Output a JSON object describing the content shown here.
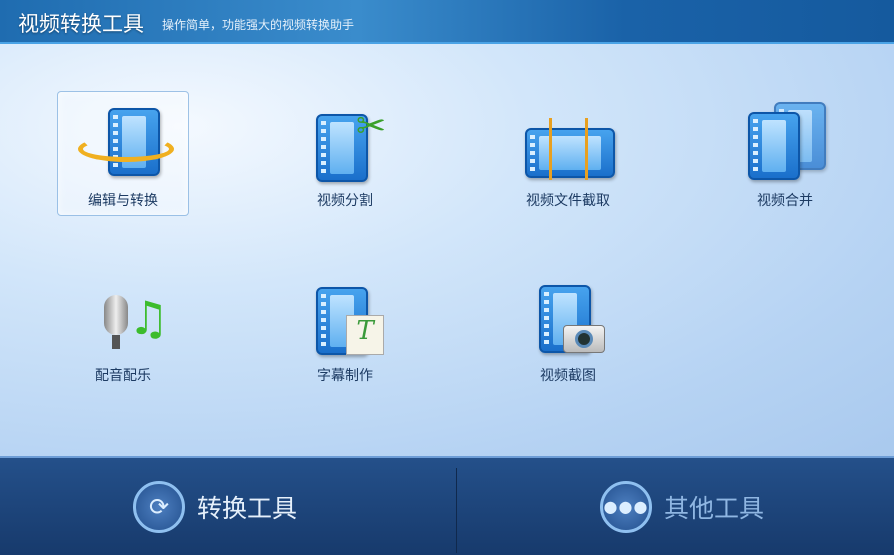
{
  "header": {
    "title": "视频转换工具",
    "subtitle": "操作简单，功能强大的视频转换助手"
  },
  "tools": [
    {
      "label": "编辑与转换",
      "icon": "film-convert-icon",
      "selected": true
    },
    {
      "label": "视频分割",
      "icon": "film-scissors-icon"
    },
    {
      "label": "视频文件截取",
      "icon": "film-clip-icon"
    },
    {
      "label": "视频合并",
      "icon": "film-merge-icon"
    },
    {
      "label": "配音配乐",
      "icon": "microphone-music-icon"
    },
    {
      "label": "字幕制作",
      "icon": "film-subtitle-icon"
    },
    {
      "label": "视频截图",
      "icon": "film-camera-icon"
    }
  ],
  "footer": {
    "convert_label": "转换工具",
    "other_label": "其他工具"
  },
  "colors": {
    "header": "#1f6cb0",
    "footer": "#1d4479",
    "label": "#1d3b63"
  }
}
